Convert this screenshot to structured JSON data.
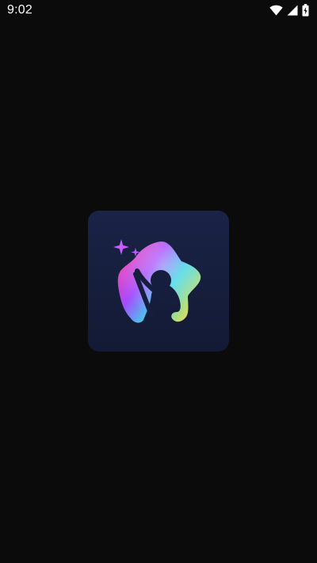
{
  "status_bar": {
    "time": "9:02",
    "icons": [
      "wifi-icon",
      "cellular-signal-icon",
      "battery-charging-icon"
    ]
  },
  "splash": {
    "logo_icon": "star-person-logo-icon",
    "colors": {
      "background": "#0b0b0b",
      "logo_tile_top": "#1a2346",
      "logo_tile_bottom": "#131a35",
      "gradient_pink": "#ff3fa4",
      "gradient_purple": "#8a4dff",
      "gradient_cyan": "#3ed6e6",
      "gradient_yellow": "#ffe33a",
      "sparkle": "#c85cff"
    }
  }
}
